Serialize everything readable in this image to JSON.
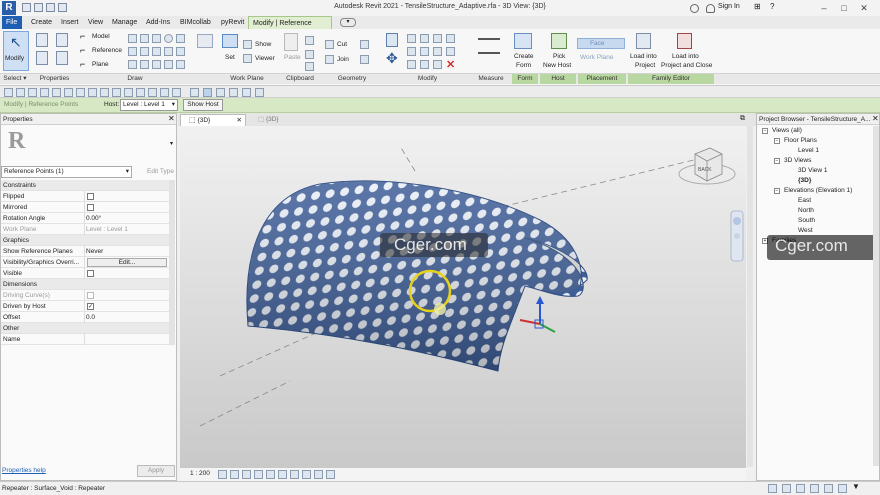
{
  "app": {
    "logo": "R",
    "title": "Autodesk Revit 2021 - TensileStructure_Adaptive.rfa - 3D View: {3D}",
    "sign_in": "Sign In"
  },
  "tabs": [
    {
      "label": "File"
    },
    {
      "label": "Create"
    },
    {
      "label": "Insert"
    },
    {
      "label": "View"
    },
    {
      "label": "Manage"
    },
    {
      "label": "Add-Ins"
    },
    {
      "label": "BIMcollab"
    },
    {
      "label": "pyRevit"
    },
    {
      "label": "Modify | Reference Points"
    }
  ],
  "ribbon": {
    "modify_label": "Modify",
    "select_label": "Select ▾",
    "properties_label": "Properties",
    "draw_label": "Draw",
    "draw_model": "Model",
    "draw_reference": "Reference",
    "draw_plane": "Plane",
    "workplane_label": "Work Plane",
    "workplane_set": "Set",
    "workplane_show": "Show",
    "workplane_viewer": "Viewer",
    "clipboard_label": "Clipboard",
    "clipboard_paste": "Paste",
    "geometry_label": "Geometry",
    "geometry_cut": "Cut",
    "geometry_join": "Join",
    "modify_panel_label": "Modify",
    "measure_label": "Measure",
    "form_label": "Form",
    "form_create": "Create",
    "form_form": "Form",
    "host_label": "Host",
    "host_pick": "Pick",
    "host_new_host": "New Host",
    "placement_label": "Placement",
    "placement_face": "Face",
    "placement_workplane": "Work Plane",
    "family_editor_label": "Family Editor",
    "load_into_project_1": "Load into",
    "load_into_project_2": "Project",
    "load_close_1": "Load into",
    "load_close_2": "Project and Close"
  },
  "options_bar": {
    "context": "Modify | Reference Points",
    "host_label": "Host:",
    "host_value": "Level : Level 1",
    "show_host": "Show Host"
  },
  "properties": {
    "title": "Properties",
    "type_selector": "Reference Points (1)",
    "edit_type": "Edit Type",
    "help_link": "Properties help",
    "apply": "Apply",
    "rows": [
      {
        "kind": "cat",
        "name": "Constraints"
      },
      {
        "kind": "chk",
        "name": "Flipped",
        "checked": false
      },
      {
        "kind": "chk",
        "name": "Mirrored",
        "checked": false
      },
      {
        "kind": "val",
        "name": "Rotation Angle",
        "value": "0.00°"
      },
      {
        "kind": "val",
        "name": "Work Plane",
        "value": "Level : Level 1",
        "dim": true
      },
      {
        "kind": "cat",
        "name": "Graphics"
      },
      {
        "kind": "val",
        "name": "Show Reference Planes",
        "value": "Never"
      },
      {
        "kind": "btn",
        "name": "Visibility/Graphics Overri...",
        "value": "Edit..."
      },
      {
        "kind": "chk",
        "name": "Visible",
        "checked": false
      },
      {
        "kind": "cat",
        "name": "Dimensions"
      },
      {
        "kind": "chk",
        "name": "Driving Curve(s)",
        "checked": false,
        "dim": true
      },
      {
        "kind": "chk",
        "name": "Driven by Host",
        "checked": true
      },
      {
        "kind": "val",
        "name": "Offset",
        "value": "0.0"
      },
      {
        "kind": "cat",
        "name": "Other"
      },
      {
        "kind": "val",
        "name": "Name",
        "value": ""
      }
    ]
  },
  "view_tabs": [
    {
      "label": "{3D}"
    },
    {
      "label": "{3D}"
    }
  ],
  "viewport": {
    "scale": "1 : 200",
    "viewcube_face": "BACK",
    "watermark": "Cger.com"
  },
  "project_browser": {
    "title": "Project Browser - TensileStructure_A...",
    "items": [
      {
        "label": "Views (all)",
        "level": 0,
        "toggle": "−"
      },
      {
        "label": "Floor Plans",
        "level": 1,
        "toggle": "−"
      },
      {
        "label": "Level 1",
        "level": 2
      },
      {
        "label": "3D Views",
        "level": 1,
        "toggle": "−"
      },
      {
        "label": "3D View 1",
        "level": 2
      },
      {
        "label": "{3D}",
        "level": 2,
        "bold": true
      },
      {
        "label": "Elevations (Elevation 1)",
        "level": 1,
        "toggle": "−"
      },
      {
        "label": "East",
        "level": 2
      },
      {
        "label": "North",
        "level": 2
      },
      {
        "label": "South",
        "level": 2
      },
      {
        "label": "West",
        "level": 2
      },
      {
        "label": "Families",
        "level": 0,
        "toggle": "+"
      }
    ],
    "watermark": "Cger.com"
  },
  "status_bar": {
    "text": "Repeater : Surface_Void : Repeater"
  }
}
